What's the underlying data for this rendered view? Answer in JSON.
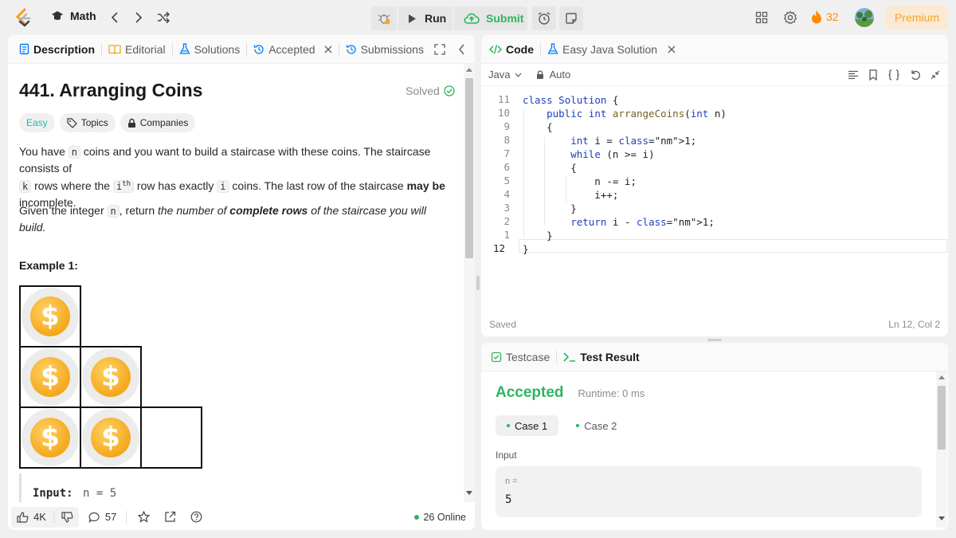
{
  "topbar": {
    "problem_list": "Math",
    "run_label": "Run",
    "submit_label": "Submit",
    "streak": "32",
    "premium_label": "Premium"
  },
  "left_tabs": [
    {
      "label": "Description"
    },
    {
      "label": "Editorial"
    },
    {
      "label": "Solutions"
    },
    {
      "label": "Accepted"
    },
    {
      "label": "Submissions"
    }
  ],
  "problem": {
    "title": "441. Arranging Coins",
    "status": "Solved",
    "difficulty": "Easy",
    "topics_label": "Topics",
    "companies_label": "Companies",
    "p1_a": "You have ",
    "p1_code_n": "n",
    "p1_b": " coins and you want to build a staircase with these coins. The staircase consists of",
    "p1_code_k": "k",
    "p1_c": " rows where the ",
    "p1_code_i": "i",
    "p1_sup": "th",
    "p1_d": " row has exactly ",
    "p1_code_i2": "i",
    "p1_e": " coins. The last row of the staircase ",
    "p1_bold": "may be",
    "p1_f": "incomplete.",
    "p2_a": "Given the integer ",
    "p2_code": "n",
    "p2_b": ", return ",
    "p2_it1": "the number of ",
    "p2_bold": "complete rows",
    "p2_it2": " of the staircase you will build.",
    "example_title": "Example 1:",
    "example_input_label": "Input:",
    "example_input_value": "n = 5",
    "coin_symbol": "$"
  },
  "left_footer": {
    "likes": "4K",
    "comments": "57",
    "online": "26 Online"
  },
  "code_tabs": [
    {
      "label": "Code"
    },
    {
      "label": "Easy Java Solution"
    }
  ],
  "editor": {
    "language": "Java",
    "mode": "Auto",
    "saved": "Saved",
    "cursor": "Ln 12, Col 2",
    "line_numbers": [
      "11",
      "10",
      "9",
      "8",
      "7",
      "6",
      "5",
      "4",
      "3",
      "2",
      "1",
      "12"
    ],
    "lines": [
      "class Solution {",
      "    public int arrangeCoins(int n)",
      "    {",
      "        int i = 1;",
      "        while (n >= i)",
      "        {",
      "            n -= i;",
      "            i++;",
      "        }",
      "        return i - 1;",
      "    }",
      "}"
    ]
  },
  "result": {
    "tab_testcase": "Testcase",
    "tab_result": "Test Result",
    "status": "Accepted",
    "runtime": "Runtime: 0 ms",
    "case1": "Case 1",
    "case2": "Case 2",
    "input_label": "Input",
    "var_label": "n =",
    "var_value": "5"
  },
  "colors": {
    "accent_green": "#2db55d",
    "premium_bg": "#fbe9d4",
    "premium_text": "#f5a623",
    "streak": "#ff8a00"
  }
}
